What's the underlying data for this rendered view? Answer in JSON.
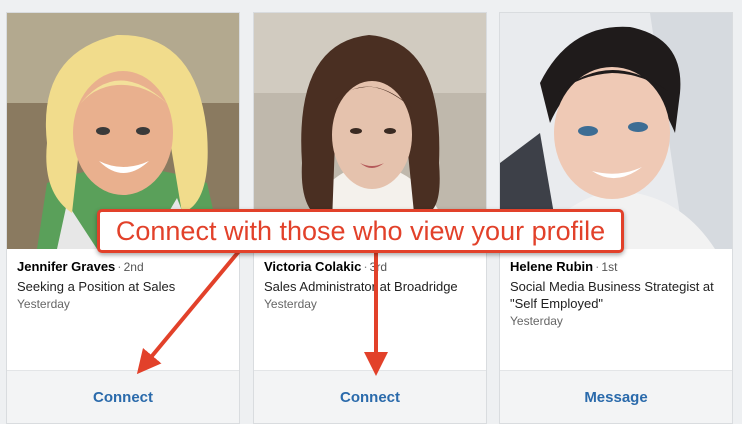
{
  "cards": [
    {
      "name": "Jennifer Graves",
      "degree": "2nd",
      "headline": "Seeking a Position at Sales",
      "time": "Yesterday",
      "action": "Connect",
      "photo": "photo-jennifer-graves"
    },
    {
      "name": "Victoria Colakic",
      "degree": "3rd",
      "headline": "Sales Administrator at Broadridge",
      "time": "Yesterday",
      "action": "Connect",
      "photo": "photo-victoria-colakic"
    },
    {
      "name": "Helene Rubin",
      "degree": "1st",
      "headline": "Social Media Business Strategist at \"Self Employed\"",
      "time": "Yesterday",
      "action": "Message",
      "photo": "photo-helene-rubin"
    }
  ],
  "annotation": {
    "text": "Connect with those who view your profile",
    "color": "#e2412a"
  },
  "colors": {
    "action_text": "#2a6aab",
    "action_bg": "#f3f4f5"
  }
}
